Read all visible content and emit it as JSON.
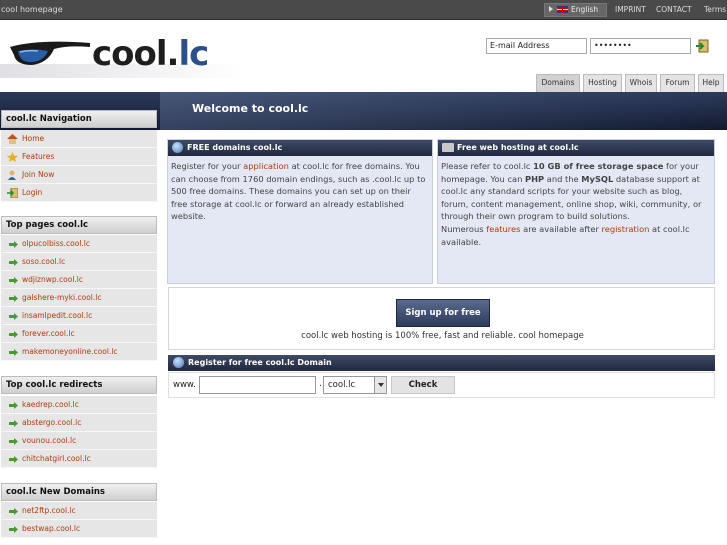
{
  "topbar": {
    "home_label": "cool homepage",
    "language": "English",
    "links": [
      "IMPRINT",
      "CONTACT",
      "Terms"
    ]
  },
  "header": {
    "logo_text_main": "cool.",
    "logo_text_accent": "lc",
    "email_placeholder": "E-mail Address",
    "password_value": "••••••••"
  },
  "tabs": [
    "Domains",
    "Hosting",
    "Whois",
    "Forum",
    "Help"
  ],
  "banner": {
    "title": "Welcome to cool.lc"
  },
  "sidebar": {
    "navigation": {
      "heading": "cool.lc Navigation",
      "items": [
        {
          "label": "Home",
          "icon": "home-icon"
        },
        {
          "label": "Features",
          "icon": "star-icon"
        },
        {
          "label": "Join Now",
          "icon": "user-add-icon"
        },
        {
          "label": "Login",
          "icon": "login-icon"
        }
      ]
    },
    "top_pages": {
      "heading": "Top pages cool.lc",
      "items": [
        "olpucolbiss.cool.lc",
        "soso.cool.lc",
        "wdjiznwp.cool.lc",
        "galshere-myki.cool.lc",
        "insamlpedit.cool.lc",
        "forever.cool.lc",
        "makemoneyonline.cool.lc"
      ]
    },
    "top_redirects": {
      "heading": "Top cool.lc redirects",
      "items": [
        "kaedrep.cool.lc",
        "abstergo.cool.lc",
        "vounou.cool.lc",
        "chitchatgirl.cool.lc"
      ]
    },
    "new_domains": {
      "heading": "cool.lc New Domains",
      "items": [
        "net2ftp.cool.lc",
        "bestwap.cool.lc"
      ]
    }
  },
  "free_domains": {
    "title": "FREE domains cool.lc",
    "text_1": "Register for your",
    "link_1": "application",
    "text_2": "at cool.lc for free domains. You can choose from 1760 domain endings, such as .cool.lc up to 500 free domains. These domains you can set up on their free storage at cool.lc or forward an already established website."
  },
  "free_hosting": {
    "title": "Free web hosting at cool.lc",
    "text_1": "Please refer to cool.lc",
    "bold_1": "10 GB of free storage space",
    "text_2": "for your homepage. You can",
    "bold_2": "PHP",
    "text_3": "and the",
    "bold_3": "MySQL",
    "text_4": "database support at cool.lc any standard scripts for your website such as blog, forum, content management, online shop, wiki, community, or through their own program to build solutions.",
    "text_5": "Numerous",
    "link_features": "features",
    "text_6": "are available after",
    "link_registration": "registration",
    "text_7": "at cool.lc available."
  },
  "signup": {
    "button": "Sign up for free",
    "text": "cool.lc web hosting is 100% free, fast and reliable. cool homepage"
  },
  "register": {
    "title": "Register for free cool.lc Domain",
    "prefix": "www.",
    "dot": ".",
    "domain_selected": "cool.lc",
    "check_button": "Check"
  }
}
